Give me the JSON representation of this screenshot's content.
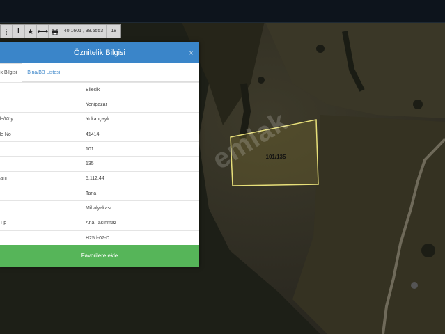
{
  "toolbar": {
    "coordinate_lat": "40.1601",
    "coordinate_lon": "38.5553",
    "zoom": "18",
    "icons": [
      "info-icon",
      "star-icon",
      "measure-icon",
      "print-icon"
    ]
  },
  "watermark": "emlak",
  "parcel_label": "101/135",
  "dialog": {
    "title": "Öznitelik Bilgisi",
    "close": "×",
    "tabs": [
      "itelik Bilgisi",
      "Bina/BB Listesi"
    ],
    "rows": [
      {
        "key": "",
        "value": "Bilecik"
      },
      {
        "key": "",
        "value": "Yenipazar"
      },
      {
        "key": "alle/Köy",
        "value": "Yukançaylı"
      },
      {
        "key": "alle No",
        "value": "41414"
      },
      {
        "key": "",
        "value": "101"
      },
      {
        "key": "el",
        "value": "135"
      },
      {
        "key": "Alanı",
        "value": "5.112,44"
      },
      {
        "key": "k",
        "value": "Tarla"
      },
      {
        "key": "i",
        "value": "Mihalyakası"
      },
      {
        "key": "n Tip",
        "value": "Ana Taşınmaz"
      },
      {
        "key": "",
        "value": "H25d-07-D"
      }
    ],
    "favorite_button": "Favorilere ekle"
  },
  "colors": {
    "header": "#3a85c9",
    "button": "#56b559",
    "parcel_outline": "#e8e07a"
  }
}
